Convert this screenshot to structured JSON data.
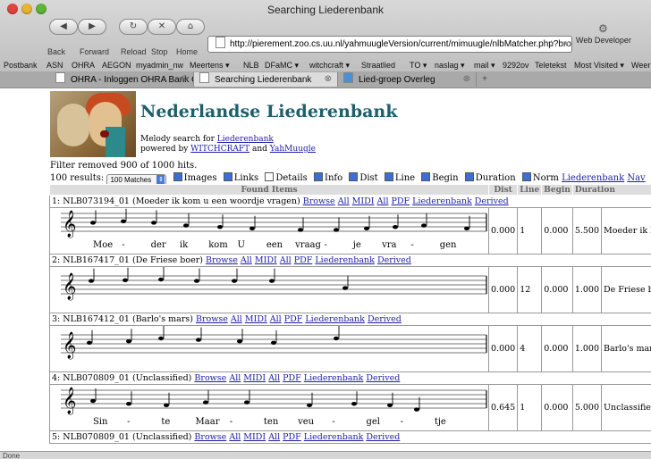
{
  "window": {
    "title": "Searching Liederenbank"
  },
  "toolbar": {
    "back_label": "Back",
    "forward_label": "Forward",
    "reload_label": "Reload",
    "stop_label": "Stop",
    "home_label": "Home",
    "url": "http://pierement.zoo.cs.uu.nl/yahmuugleVersion/current/mimuugle/nlbMatcher.php?browseM",
    "web_developer_label": "Web Developer"
  },
  "bookmarks": [
    "Postbank",
    "ASN",
    "OHRA",
    "AEGON",
    "myadmin_nw",
    "Meertens ▾",
    "NLB",
    "DFaMC ▾",
    "witchcraft ▾",
    "Straatlied",
    "TO ▾",
    "naslag ▾",
    "mail ▾",
    "9292ov",
    "Teletekst",
    "Most Visited ▾",
    "Weer"
  ],
  "tabs": [
    {
      "label": "OHRA - Inloggen OHRA Bank O...",
      "active": false
    },
    {
      "label": "Searching Liederenbank",
      "active": true
    },
    {
      "label": "Lied-groep Overleg",
      "active": false
    }
  ],
  "page": {
    "title": "Nederlandse Liederenbank",
    "subtitle_prefix": "Melody search for ",
    "subtitle_link": "Liederenbank",
    "powered_prefix": "powered by ",
    "powered_link1": "WITCHCRAFT",
    "powered_and": " and ",
    "powered_link2": "YahMuugle",
    "filter_text": "Filter removed 900 of 1000 hits.",
    "results_label": "100 results:",
    "results_select": "100 Matches",
    "checkboxes": [
      {
        "label": "Images",
        "checked": true
      },
      {
        "label": "Links",
        "checked": true
      },
      {
        "label": "Details",
        "checked": false
      },
      {
        "label": "Info",
        "checked": true
      },
      {
        "label": "Dist",
        "checked": true
      },
      {
        "label": "Line",
        "checked": true
      },
      {
        "label": "Begin",
        "checked": true
      },
      {
        "label": "Duration",
        "checked": true
      },
      {
        "label": "Norm",
        "checked": true
      }
    ],
    "nav_links": [
      "Liederenbank",
      "Nav"
    ]
  },
  "table": {
    "columns": [
      "Found Items",
      "Dist",
      "Line",
      "Begin",
      "Duration"
    ],
    "link_labels": [
      "Browse",
      "All",
      "MIDI",
      "All",
      "PDF",
      "Liederenbank",
      "Derived"
    ],
    "rows": [
      {
        "header": "1: NLB073194_01 (Moeder ik kom u een woordje vragen)",
        "dist": "0.000",
        "line": "1",
        "begin": "0.000",
        "duration": "5.500",
        "title": "Moeder ik kom",
        "lyrics": [
          "Moe",
          "-",
          "der",
          "ik",
          "kom",
          "U",
          "een",
          "vraag",
          "-",
          "je",
          "vra",
          "-",
          "gen"
        ]
      },
      {
        "header": "2: NLB167417_01 (De Friese boer)",
        "dist": "0.000",
        "line": "12",
        "begin": "0.000",
        "duration": "1.000",
        "title": "De Friese boer",
        "lyrics": []
      },
      {
        "header": "3: NLB167412_01 (Barlo's mars)",
        "dist": "0.000",
        "line": "4",
        "begin": "0.000",
        "duration": "1.000",
        "title": "Barlo's mars",
        "lyrics": []
      },
      {
        "header": "4: NLB070809_01 (Unclassified)",
        "dist": "0.645",
        "line": "1",
        "begin": "0.000",
        "duration": "5.000",
        "title": "Unclassified",
        "lyrics": [
          "Sin",
          "-",
          "te",
          "Maar",
          "-",
          "ten",
          "veu",
          "-",
          "gel",
          "-",
          "tje"
        ]
      },
      {
        "header": "5: NLB070809_01 (Unclassified)"
      }
    ]
  },
  "status": "Done"
}
